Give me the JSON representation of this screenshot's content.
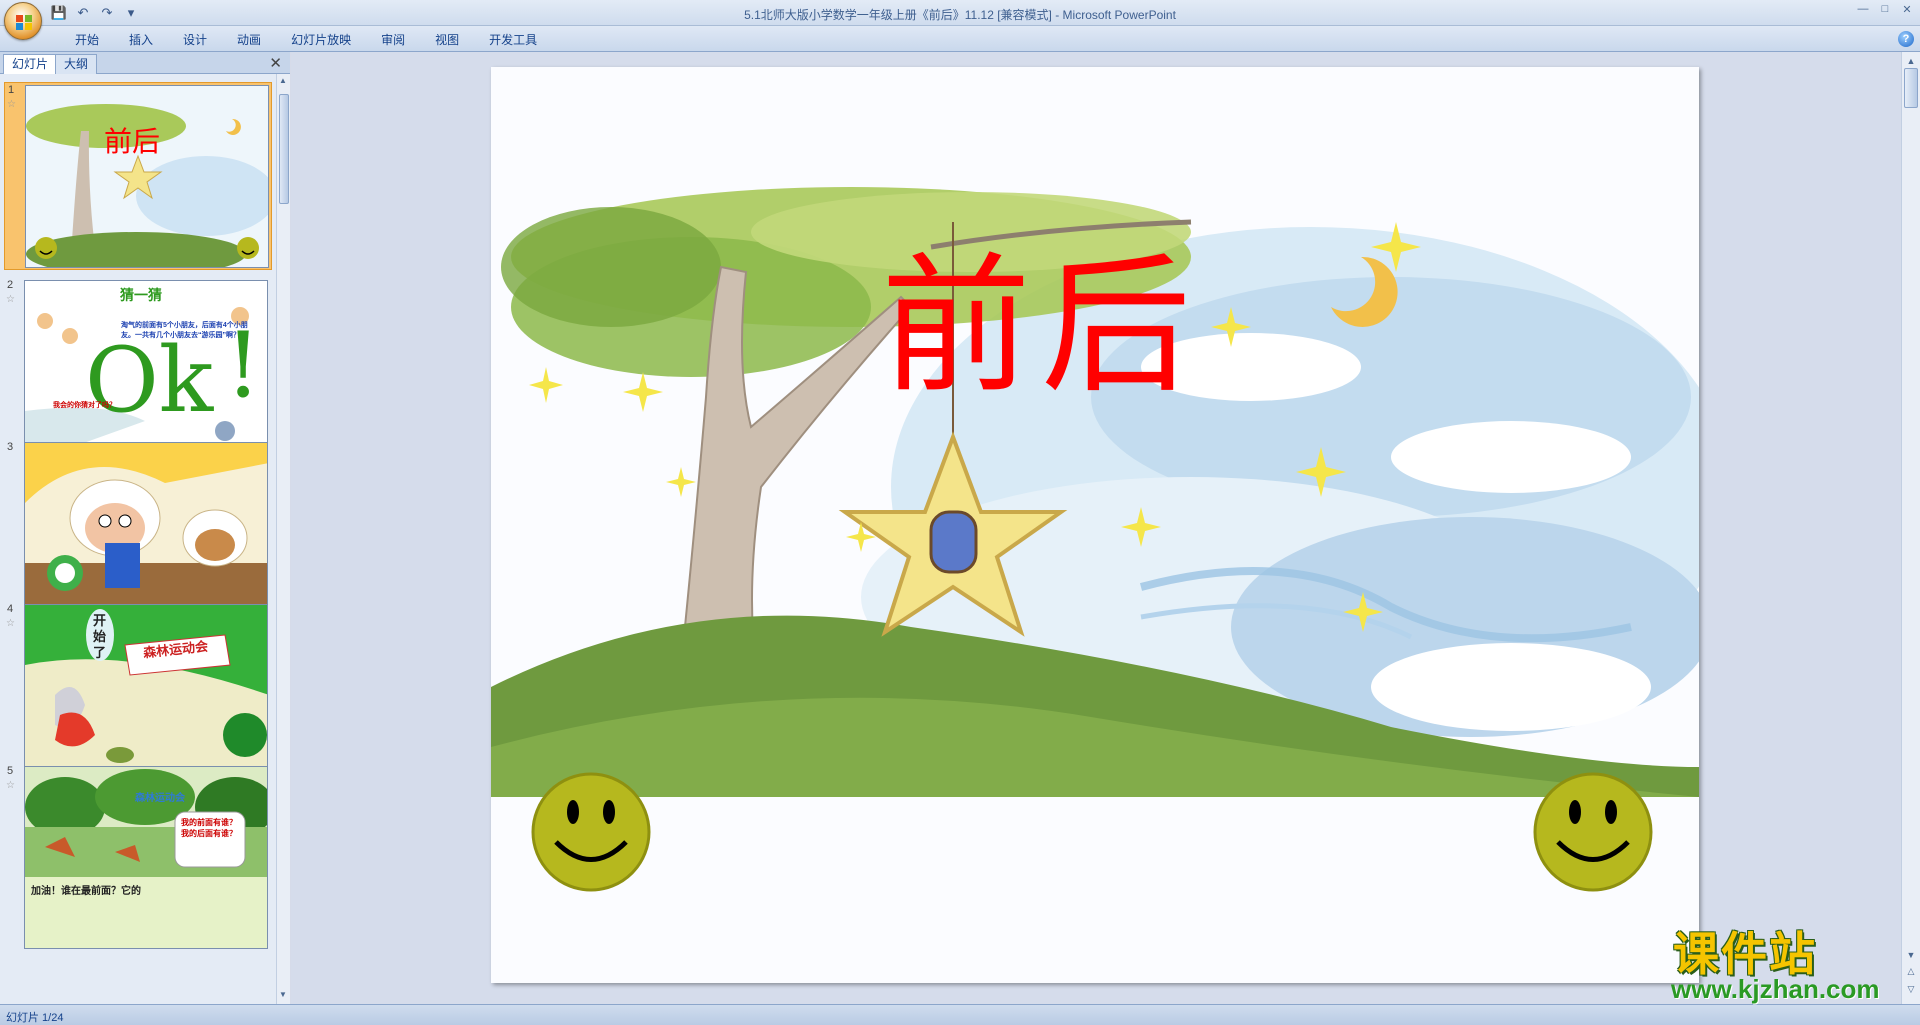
{
  "window": {
    "title": "5.1北师大版小学数学一年级上册《前后》11.12 [兼容模式] - Microsoft PowerPoint"
  },
  "quick_access": {
    "save_icon": "save-icon",
    "undo_icon": "undo-icon",
    "redo_icon": "redo-icon",
    "customize_icon": "dropdown-icon"
  },
  "ribbon": {
    "tabs": [
      "开始",
      "插入",
      "设计",
      "动画",
      "幻灯片放映",
      "审阅",
      "视图",
      "开发工具"
    ]
  },
  "left_pane": {
    "tab_slides": "幻灯片",
    "tab_outline": "大纲",
    "close": "✕",
    "slides": [
      {
        "num": "1",
        "title": "前后"
      },
      {
        "num": "2",
        "title": "猜一猜",
        "text1": "淘气的前面有5个小朋友，后面有4个小朋友。一共有几个小朋友去“游乐园”啊？",
        "text2": "我会的你猜对了吗？"
      },
      {
        "num": "3"
      },
      {
        "num": "4",
        "text1": "开始了",
        "text2": "森林运动会"
      },
      {
        "num": "5",
        "text1": "森林运动会",
        "text2": "我的前面有谁？我的后面有谁？",
        "text3": "加油！谁在最前面？它的"
      }
    ]
  },
  "slide": {
    "title": "前后"
  },
  "status_bar": {
    "slide_info": "幻灯片 1/24"
  },
  "watermark": {
    "title": "课件站",
    "url": "www.kjzhan.com"
  }
}
